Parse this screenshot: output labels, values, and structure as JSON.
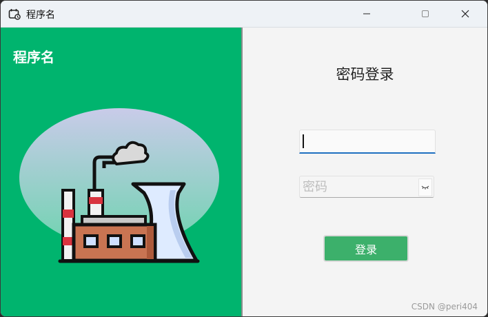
{
  "window": {
    "title": "程序名",
    "controls": [
      "minimize",
      "maximize",
      "close"
    ]
  },
  "left_panel": {
    "title": "程序名",
    "background_color": "#00b46e",
    "illustration_icon": "factory-icon"
  },
  "login": {
    "title": "密码登录",
    "username_value": "",
    "password_placeholder": "密码",
    "password_toggle_icon": "eye-closed-icon",
    "submit_label": "登录",
    "submit_color": "#3cb06b",
    "focus_color": "#1d6fc0"
  },
  "watermark": "CSDN @peri404"
}
